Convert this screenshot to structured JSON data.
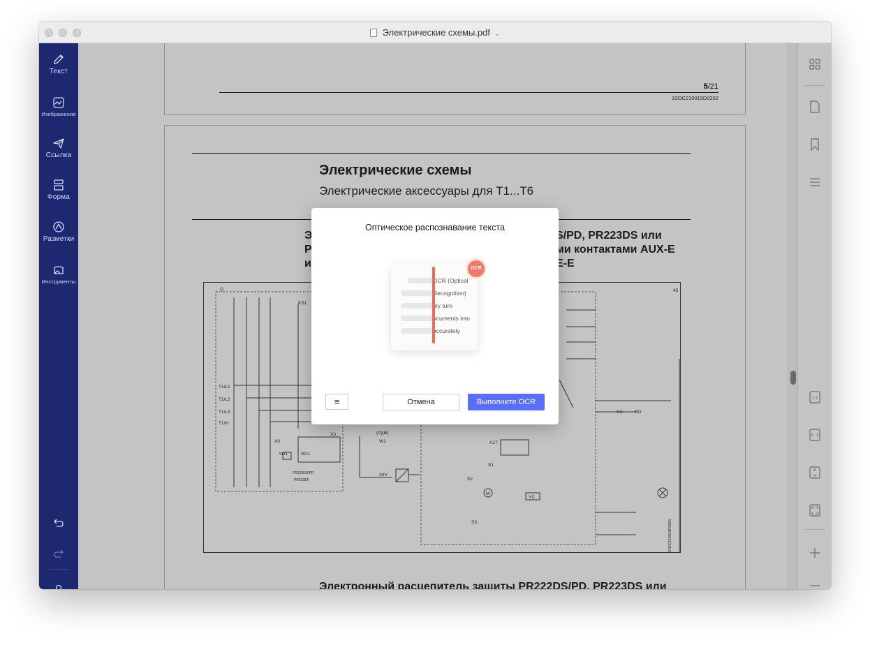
{
  "window": {
    "title": "Электрические схемы.pdf"
  },
  "left_toolbar": {
    "items": [
      {
        "label": "Текст",
        "icon": "pencil-icon"
      },
      {
        "label": "Изображение",
        "icon": "image-icon"
      },
      {
        "label": "Ссылка",
        "icon": "link-send-icon"
      },
      {
        "label": "Форма",
        "icon": "form-icon"
      },
      {
        "label": "Разметки",
        "icon": "markup-icon"
      },
      {
        "label": "Инструменты",
        "icon": "tools-icon"
      }
    ],
    "bottom_icons": [
      "undo-icon",
      "redo-icon",
      "user-icon"
    ]
  },
  "right_toolbar": {
    "icons": [
      "grid-view-icon",
      "page-icon",
      "bookmark-icon",
      "outline-icon",
      "actual-size-icon",
      "fit-width-icon",
      "fit-height-icon",
      "fit-page-icon",
      "zoom-in-icon",
      "zoom-out-icon"
    ]
  },
  "document": {
    "prev_page_number_bold": "5",
    "prev_page_number_rest": "/21",
    "prev_page_code": "1SDC210015D0202",
    "heading": "Электрические схемы",
    "subheading": "Электрические аксессуары для T1...T6",
    "section_title_left": [
      "Э",
      "P",
      "и"
    ],
    "section_title_right": [
      "S/PD, PR223DS или",
      "ми контактами AUX-E",
      "E-E"
    ],
    "bottom_heading": "Электронный расцепитель защиты PR222DS/PD, PR223DS или",
    "diagram_labels": [
      "Q",
      "KS1",
      "T1/L1",
      "T1/L2",
      "T1/L3",
      "T1/N",
      "X0",
      "YO1",
      "X3",
      "SO1",
      "A17",
      "S1",
      "S2",
      "S3",
      "M",
      "YC",
      "24V",
      "W1",
      "(A)(B)",
      "SC",
      "SO",
      "PR223DS/PD",
      "PR223EF",
      "1SDC210016F0001",
      "45"
    ]
  },
  "ocr_dialog": {
    "title": "Оптическое распознавание текста",
    "badge": "OCR",
    "illustration_lines": [
      "OCR (Optical",
      "Recognition)",
      "ely turn",
      "ocuments into",
      "accurately"
    ],
    "cancel_label": "Отмена",
    "run_label": "Выполните OCR",
    "menu_icon": "menu-icon"
  },
  "colors": {
    "sidebar": "#1e2870",
    "primary_button": "#5b6ef7",
    "ocr_accent": "#ef6a56"
  }
}
